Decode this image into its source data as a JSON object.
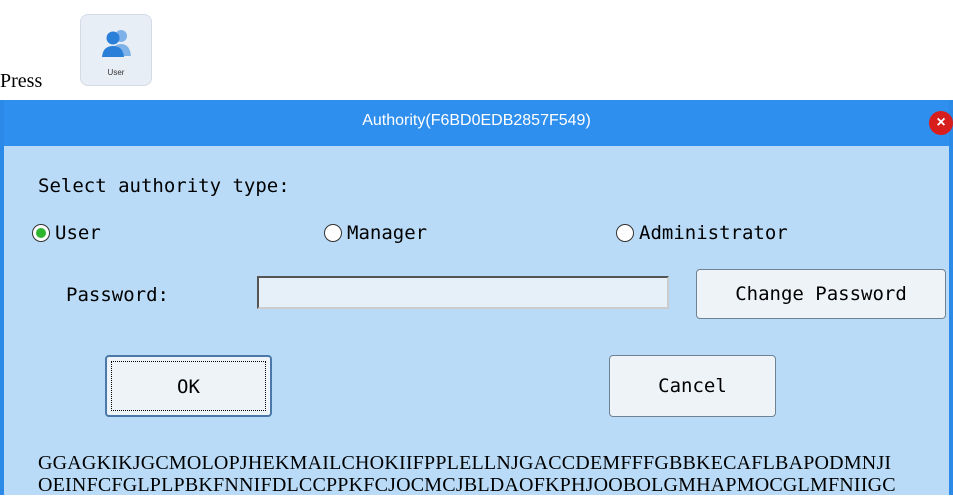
{
  "instruction": {
    "text": "Press"
  },
  "user_tile": {
    "label": "User",
    "icon": "user-group-icon"
  },
  "dialog": {
    "title": "Authority(F6BD0EDB2857F549)",
    "close_symbol": "×",
    "select_label": "Select authority type:",
    "radios": [
      {
        "label": "User",
        "selected": true
      },
      {
        "label": "Manager",
        "selected": false
      },
      {
        "label": "Administrator",
        "selected": false
      }
    ],
    "password_label": "Password:",
    "password_value": "",
    "change_password_label": "Change Password",
    "ok_label": "OK",
    "cancel_label": "Cancel",
    "code_lines": [
      "GGAGKIKJGCMOLOPJHEKMAILCHOKIIFPPLELLNJGACCDEMFFFGBBKECAFLBAPODMNJI",
      "OEINFCFGLPLPBKFNNIFDLCCPPKFCJOCMCJBLDAOFKPHJOOBOLGMHAPMOCGLMFNIIGC"
    ]
  },
  "colors": {
    "titlebar": "#2f8fee",
    "dialog_bg": "#b9dbf7",
    "radio_selected": "#2db52d",
    "close": "#d81d1d"
  }
}
